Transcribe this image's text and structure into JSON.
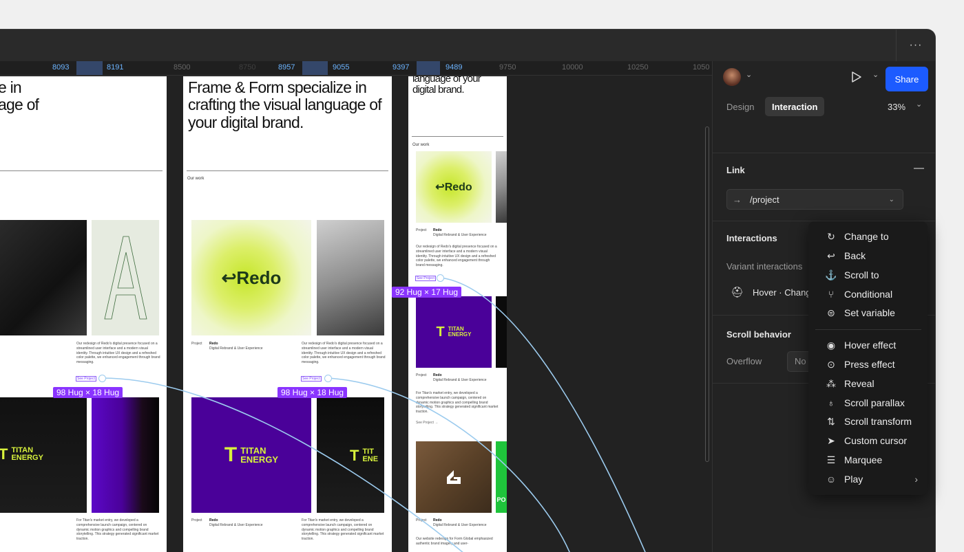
{
  "window": {
    "more_label": "···"
  },
  "ruler": {
    "ticks": [
      {
        "label": "8093",
        "highlight": true
      },
      {
        "label": "8191",
        "highlight": true
      },
      {
        "label": "8500",
        "highlight": false
      },
      {
        "label": "8750",
        "highlight": false,
        "dim": true
      },
      {
        "label": "8957",
        "highlight": true
      },
      {
        "label": "9055",
        "highlight": true
      },
      {
        "label": "9397",
        "highlight": true
      },
      {
        "label": "9489",
        "highlight": true
      },
      {
        "label": "9750",
        "highlight": false
      },
      {
        "label": "10000",
        "highlight": false
      },
      {
        "label": "10250",
        "highlight": false
      },
      {
        "label": "1050",
        "highlight": false
      }
    ]
  },
  "canvas": {
    "frame1": {
      "hero_partial": "e in\nage of",
      "caption": "Our redesign of Redo's digital presence focused on a streamlined user interface and a modern visual identity. Through intuitive UX design and a refreshed color palette, we enhanced engagement through brand messaging.",
      "see_project": "See Project",
      "badge": "98 Hug × 18 Hug",
      "titan_partial": "TITAN\nENERGY",
      "caption2": "For Titan's market entry, we developed a comprehensive launch campaign, centered on dynamic motion graphics and compelling brand storytelling. This strategy generated significant market traction."
    },
    "frame2": {
      "hero": "Frame & Form specialize in crafting the visual language of your digital brand.",
      "our_work": "Our work",
      "redo_logo": "↩Redo",
      "project_label": "Project",
      "project_name": "Redo",
      "project_desc": "Digital Rebrand & User Experience",
      "caption": "Our redesign of Redo's digital presence focused on a streamlined user interface and a modern visual identity. Through intuitive UX design and a refreshed color palette, we enhanced engagement through brand messaging.",
      "see_project": "See Project",
      "badge": "98 Hug × 18 Hug",
      "titan_t": "T",
      "titan_word": "TITAN\nENERGY",
      "titan_partial": "TIT\nENE",
      "project2_label": "Project",
      "project2_name": "Redo",
      "project2_desc": "Digital Rebrand & User Experience",
      "caption2": "For Titan's market entry, we developed a comprehensive launch campaign, centered on dynamic motion graphics and compelling brand storytelling. This strategy generated significant market traction."
    },
    "frame3": {
      "hero": "language of your digital brand.",
      "our_work": "Our work",
      "redo_logo": "↩Redo",
      "project_label": "Project",
      "project_name": "Redo",
      "project_desc": "Digital Rebrand & User Experience",
      "caption": "Our redesign of Redo's digital presence focused on a streamlined user interface and a modern visual identity. Through intuitive UX design and a refreshed color palette, we enhanced engagement through brand messaging.",
      "see_project": "See Project",
      "badge": "92 Hug × 17 Hug",
      "titan_word": "TITAN\nENERGY",
      "project2_label": "Project",
      "project2_name": "Redo",
      "project2_desc": "Digital Rebrand & User Experience",
      "caption2": "For Titan's market entry, we developed a comprehensive launch campaign, centered on dynamic motion graphics and compelling brand storytelling. This strategy generated significant market traction.",
      "see_project2": "See Project →",
      "project3_label": "Project",
      "project3_name": "Redo",
      "project3_desc": "Digital Rebrand & User Experience",
      "caption3": "Our website redesign for Form Global emphasized authentic brand imagery and user-",
      "green_partial": "PO"
    }
  },
  "panel": {
    "share": "Share",
    "tabs": [
      {
        "label": "Design",
        "active": false
      },
      {
        "label": "Interaction",
        "active": true
      }
    ],
    "zoom": "33%",
    "link": {
      "title": "Link",
      "value": "/project",
      "collapse": "—"
    },
    "interactions": {
      "title": "Interactions",
      "add": "+",
      "variant_label": "Variant interactions",
      "hover_item": "Hover · Chang"
    },
    "scroll": {
      "title": "Scroll behavior",
      "overflow_label": "Overflow",
      "overflow_value": "No"
    }
  },
  "menu": {
    "items": [
      {
        "icon": "↻",
        "label": "Change to",
        "icon_name": "change-to-icon"
      },
      {
        "icon": "↩",
        "label": "Back",
        "icon_name": "back-icon"
      },
      {
        "icon": "⚓",
        "label": "Scroll to",
        "icon_name": "anchor-icon"
      },
      {
        "icon": "⑂",
        "label": "Conditional",
        "icon_name": "conditional-icon"
      },
      {
        "icon": "⊜",
        "label": "Set variable",
        "icon_name": "set-variable-icon"
      },
      {
        "icon": "◉",
        "label": "Hover effect",
        "icon_name": "hover-effect-icon"
      },
      {
        "icon": "⊙",
        "label": "Press effect",
        "icon_name": "press-effect-icon"
      },
      {
        "icon": "⁂",
        "label": "Reveal",
        "icon_name": "reveal-icon"
      },
      {
        "icon": "♁",
        "label": "Scroll parallax",
        "icon_name": "scroll-parallax-icon"
      },
      {
        "icon": "⇅",
        "label": "Scroll transform",
        "icon_name": "scroll-transform-icon"
      },
      {
        "icon": "➤",
        "label": "Custom cursor",
        "icon_name": "custom-cursor-icon"
      },
      {
        "icon": "☰",
        "label": "Marquee",
        "icon_name": "marquee-icon"
      },
      {
        "icon": "☺",
        "label": "Play",
        "icon_name": "play-icon",
        "submenu": "›"
      }
    ]
  }
}
